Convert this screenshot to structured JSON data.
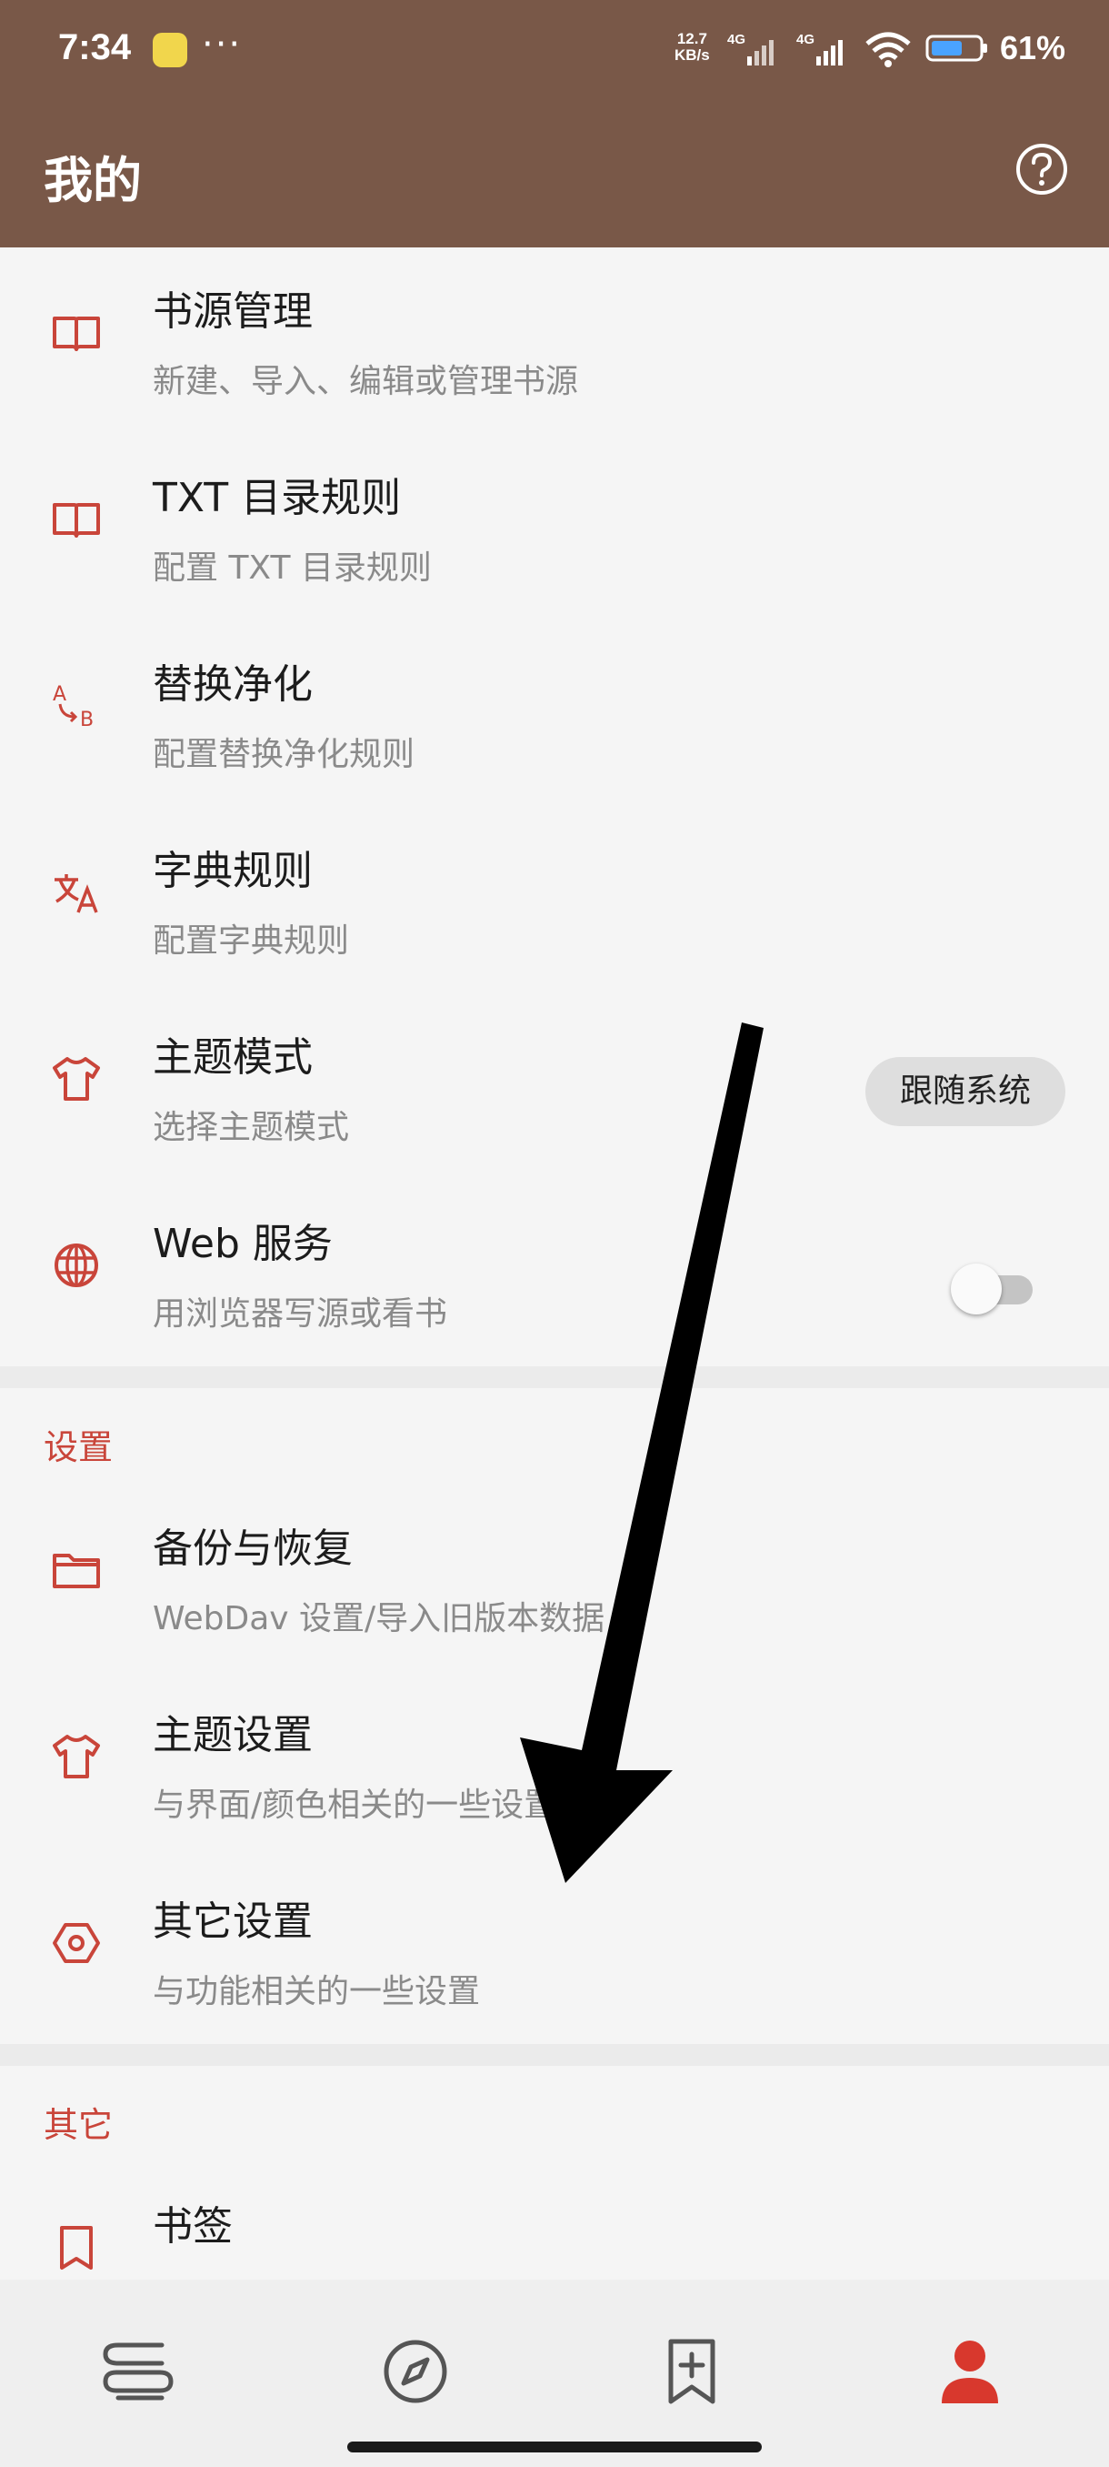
{
  "status_bar": {
    "time": "7:34",
    "more": "···",
    "net_speed": "12.7",
    "net_unit": "KB/s",
    "signal_label_1": "4G",
    "signal_label_2": "4G",
    "battery": "61%"
  },
  "app_bar": {
    "title": "我的",
    "help_icon": "help-circle-icon"
  },
  "menu_items": [
    {
      "title": "书源管理",
      "subtitle": "新建、导入、编辑或管理书源",
      "icon": "book-open-icon"
    },
    {
      "title": "TXT 目录规则",
      "subtitle": "配置 TXT 目录规则",
      "icon": "book-open-icon"
    },
    {
      "title": "替换净化",
      "subtitle": "配置替换净化规则",
      "icon": "replace-ab-icon"
    },
    {
      "title": "字典规则",
      "subtitle": "配置字典规则",
      "icon": "translate-icon"
    },
    {
      "title": "主题模式",
      "subtitle": "选择主题模式",
      "icon": "tshirt-icon",
      "chip": "跟随系统"
    },
    {
      "title": "Web 服务",
      "subtitle": "用浏览器写源或看书",
      "icon": "globe-icon",
      "toggle": false
    }
  ],
  "settings_section": {
    "header": "设置",
    "items": [
      {
        "title": "备份与恢复",
        "subtitle": "WebDav 设置/导入旧版本数据",
        "icon": "folder-icon"
      },
      {
        "title": "主题设置",
        "subtitle": "与界面/颜色相关的一些设置",
        "icon": "tshirt-icon"
      },
      {
        "title": "其它设置",
        "subtitle": "与功能相关的一些设置",
        "icon": "hexagon-settings-icon"
      }
    ]
  },
  "other_section": {
    "header": "其它",
    "items": [
      {
        "title": "书签",
        "icon": "bookmark-icon"
      }
    ]
  },
  "bottom_nav": {
    "items": [
      {
        "icon": "bookshelf-icon",
        "active": false
      },
      {
        "icon": "compass-icon",
        "active": false
      },
      {
        "icon": "bookmark-add-icon",
        "active": false
      },
      {
        "icon": "person-icon",
        "active": true
      }
    ]
  },
  "colors": {
    "brand": "#795848",
    "accent": "#c9453a",
    "background": "#f5f5f5"
  }
}
